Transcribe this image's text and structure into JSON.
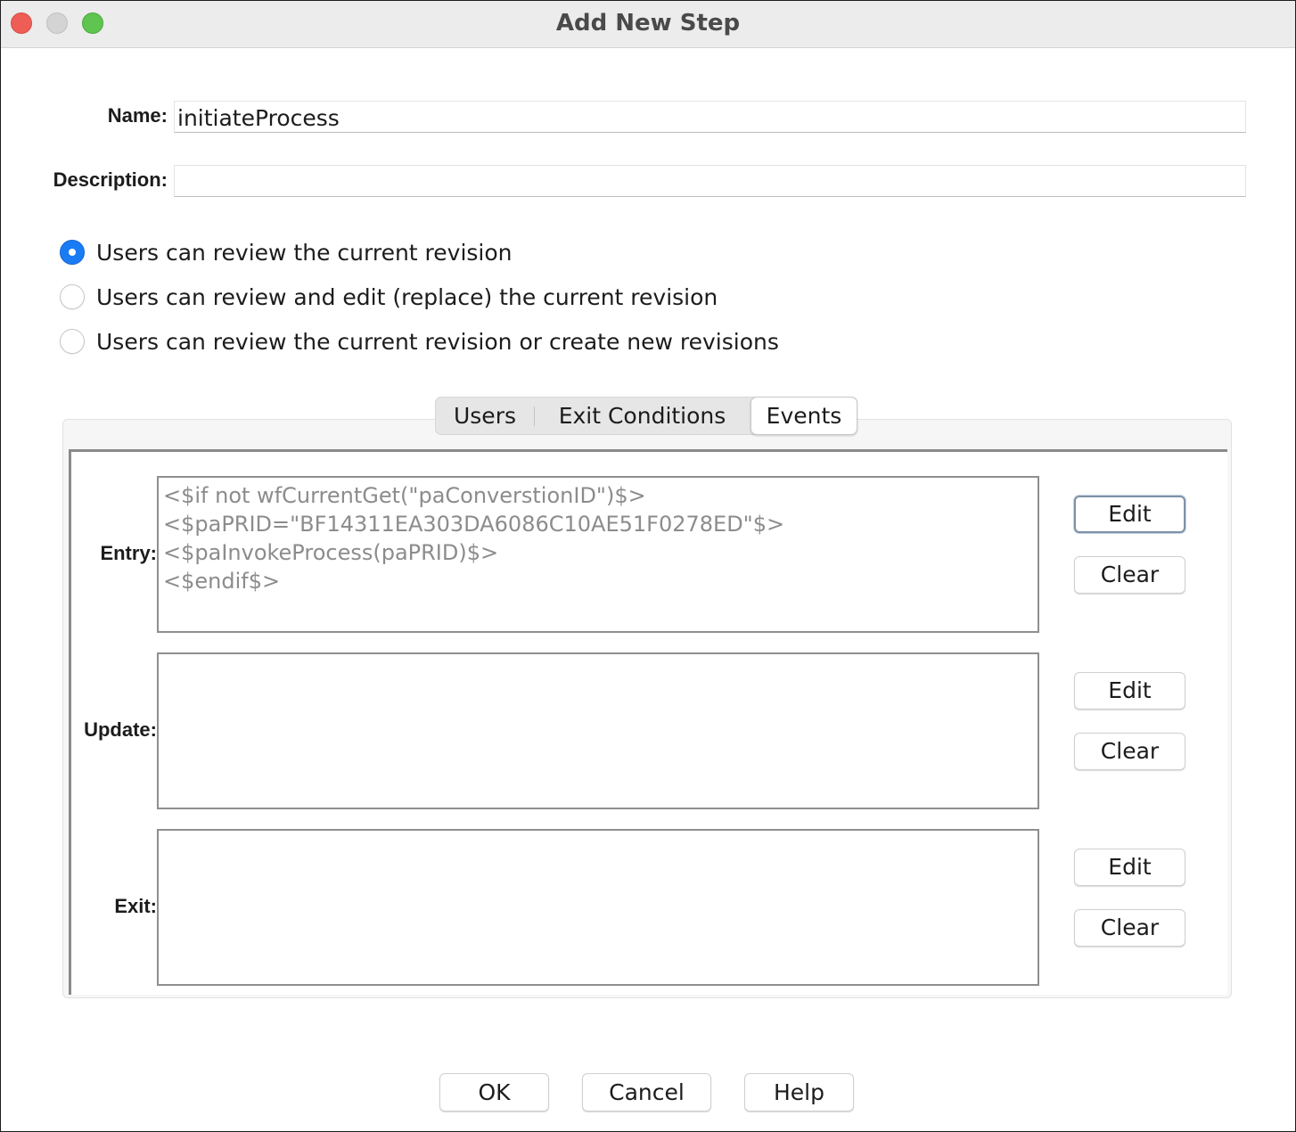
{
  "window": {
    "title": "Add New Step"
  },
  "form": {
    "name_label": "Name:",
    "name_value": "initiateProcess",
    "description_label": "Description:",
    "description_value": ""
  },
  "revision_options": [
    {
      "label": "Users can review the current revision",
      "selected": true
    },
    {
      "label": "Users can review and edit (replace) the current revision",
      "selected": false
    },
    {
      "label": "Users can review the current revision or create new revisions",
      "selected": false
    }
  ],
  "tabs": [
    {
      "label": "Users",
      "selected": false
    },
    {
      "label": "Exit Conditions",
      "selected": false
    },
    {
      "label": "Events",
      "selected": true
    }
  ],
  "events": {
    "entry": {
      "label": "Entry:",
      "script": "<$if not wfCurrentGet(\"paConverstionID\")$>\n<$paPRID=\"BF14311EA303DA6086C10AE51F0278ED\"$>\n<$paInvokeProcess(paPRID)$>\n<$endif$>",
      "edit_label": "Edit",
      "clear_label": "Clear"
    },
    "update": {
      "label": "Update:",
      "script": "",
      "edit_label": "Edit",
      "clear_label": "Clear"
    },
    "exit": {
      "label": "Exit:",
      "script": "",
      "edit_label": "Edit",
      "clear_label": "Clear"
    }
  },
  "footer": {
    "ok_label": "OK",
    "cancel_label": "Cancel",
    "help_label": "Help"
  },
  "colors": {
    "accent": "#1a7cf5",
    "close": "#ee5e56",
    "minimize": "#d4d4d4",
    "zoom": "#5fc450",
    "script_text": "#8c8c8c"
  }
}
